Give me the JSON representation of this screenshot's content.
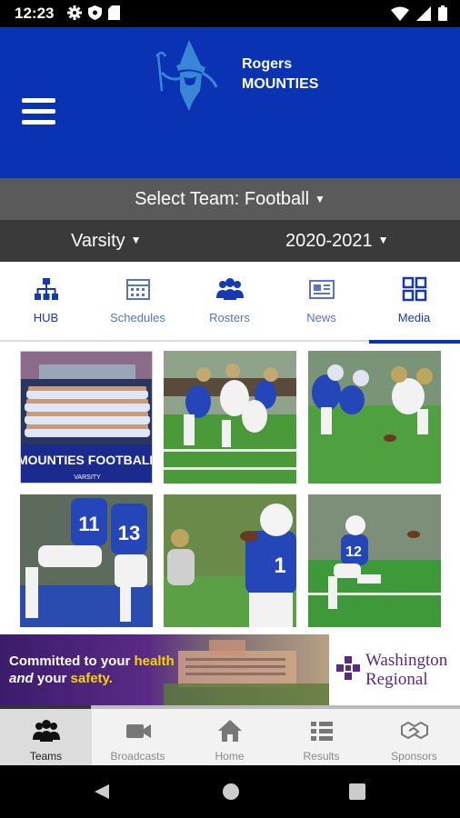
{
  "status": {
    "time": "12:23"
  },
  "header": {
    "team_line1": "Rogers",
    "team_line2": "MOUNTIES"
  },
  "select_team": {
    "label": "Select Team: Football"
  },
  "filters": {
    "level": "Varsity",
    "season": "2020-2021"
  },
  "tabs": [
    {
      "label": "HUB",
      "icon": "hierarchy-icon"
    },
    {
      "label": "Schedules",
      "icon": "calendar-icon"
    },
    {
      "label": "Rosters",
      "icon": "people-icon"
    },
    {
      "label": "News",
      "icon": "newspaper-icon"
    },
    {
      "label": "Media",
      "icon": "grid-icon"
    }
  ],
  "active_tab": "Media",
  "media": {
    "team_photo_banner": "MOUNTIES FOOTBALL",
    "team_photo_sub": "VARSITY",
    "jersey_numbers": [
      "11",
      "13",
      "12"
    ]
  },
  "ad": {
    "text_1": "Committed to your ",
    "text_1_highlight": "health",
    "text_2_italic": "and",
    "text_2": " your ",
    "text_2_highlight": "safety.",
    "brand_line1": "Washington",
    "brand_line2": "Regional"
  },
  "bottom_nav": [
    {
      "label": "Teams",
      "icon": "people-icon",
      "active": true
    },
    {
      "label": "Broadcasts",
      "icon": "video-camera-icon",
      "active": false
    },
    {
      "label": "Home",
      "icon": "home-icon",
      "active": false
    },
    {
      "label": "Results",
      "icon": "list-icon",
      "active": false
    },
    {
      "label": "Sponsors",
      "icon": "handshake-icon",
      "active": false
    }
  ],
  "colors": {
    "primary": "#0a33b3",
    "select_bar": "#5a5a5a",
    "filter_bar": "#3a3a3a",
    "ad_purple": "#5a2a86"
  }
}
